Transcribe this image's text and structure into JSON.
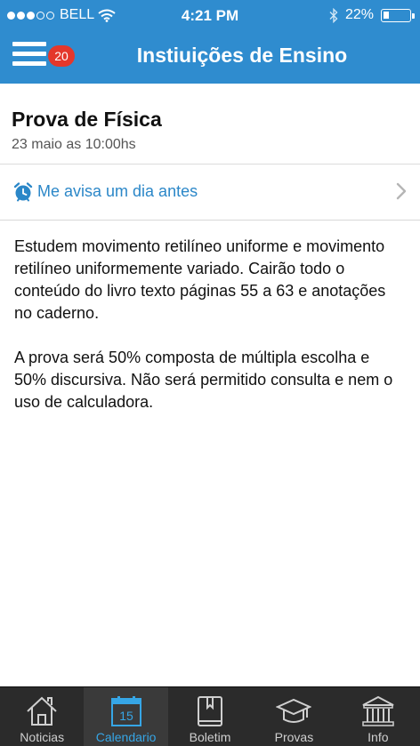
{
  "status_bar": {
    "carrier": "BELL",
    "time": "4:21 PM",
    "battery": "22%",
    "battery_level": 0.22
  },
  "nav": {
    "badge_count": "20",
    "title": "Instiuições de Ensino"
  },
  "event": {
    "title": "Prova de Física",
    "date": "23 maio as 10:00hs"
  },
  "reminder": {
    "label": "Me avisa um dia antes"
  },
  "body": {
    "paragraph1": "Estudem movimento retilíneo uniforme e movimento retilíneo uniformemente variado. Cairão todo o conteúdo do livro texto páginas 55 a 63 e anotações no caderno.",
    "paragraph2": "A prova será 50% composta de múltipla escolha e 50% discursiva. Não será permitido consulta e nem o uso de calculadora."
  },
  "tabs": [
    {
      "label": "Noticias",
      "icon": "house-icon",
      "active": false
    },
    {
      "label": "Calendario",
      "icon": "calendar-icon",
      "active": true,
      "icon_text": "15"
    },
    {
      "label": "Boletim",
      "icon": "book-icon",
      "active": false
    },
    {
      "label": "Provas",
      "icon": "graduation-cap-icon",
      "active": false
    },
    {
      "label": "Info",
      "icon": "building-icon",
      "active": false
    }
  ],
  "colors": {
    "header_blue": "#2f8ccf",
    "badge_red": "#e4372b",
    "link_blue": "#2b87c8",
    "tab_active": "#36a6e6",
    "tabbar_bg": "#2b2b2b"
  }
}
